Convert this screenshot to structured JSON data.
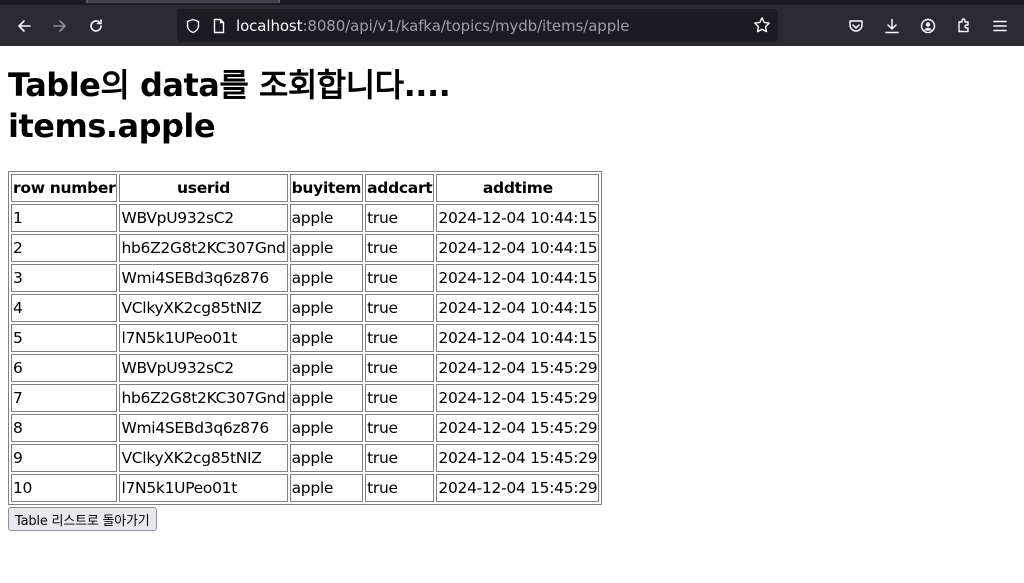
{
  "browser": {
    "url_host": "localhost",
    "url_rest": ":8080/api/v1/kafka/topics/mydb/items/apple"
  },
  "page": {
    "title": "Table의 data를 조회합니다....",
    "subtitle": "items.apple",
    "back_button": "Table 리스트로 돌아가기"
  },
  "table": {
    "headers": [
      "row number",
      "userid",
      "buyitem",
      "addcart",
      "addtime"
    ],
    "rows": [
      [
        "1",
        "WBVpU932sC2",
        "apple",
        "true",
        "2024-12-04 10:44:15"
      ],
      [
        "2",
        "hb6Z2G8t2KC307Gnd",
        "apple",
        "true",
        "2024-12-04 10:44:15"
      ],
      [
        "3",
        "Wmi4SEBd3q6z876",
        "apple",
        "true",
        "2024-12-04 10:44:15"
      ],
      [
        "4",
        "VClkyXK2cg85tNIZ",
        "apple",
        "true",
        "2024-12-04 10:44:15"
      ],
      [
        "5",
        "l7N5k1UPeo01t",
        "apple",
        "true",
        "2024-12-04 10:44:15"
      ],
      [
        "6",
        "WBVpU932sC2",
        "apple",
        "true",
        "2024-12-04 15:45:29"
      ],
      [
        "7",
        "hb6Z2G8t2KC307Gnd",
        "apple",
        "true",
        "2024-12-04 15:45:29"
      ],
      [
        "8",
        "Wmi4SEBd3q6z876",
        "apple",
        "true",
        "2024-12-04 15:45:29"
      ],
      [
        "9",
        "VClkyXK2cg85tNIZ",
        "apple",
        "true",
        "2024-12-04 15:45:29"
      ],
      [
        "10",
        "l7N5k1UPeo01t",
        "apple",
        "true",
        "2024-12-04 15:45:29"
      ]
    ]
  }
}
